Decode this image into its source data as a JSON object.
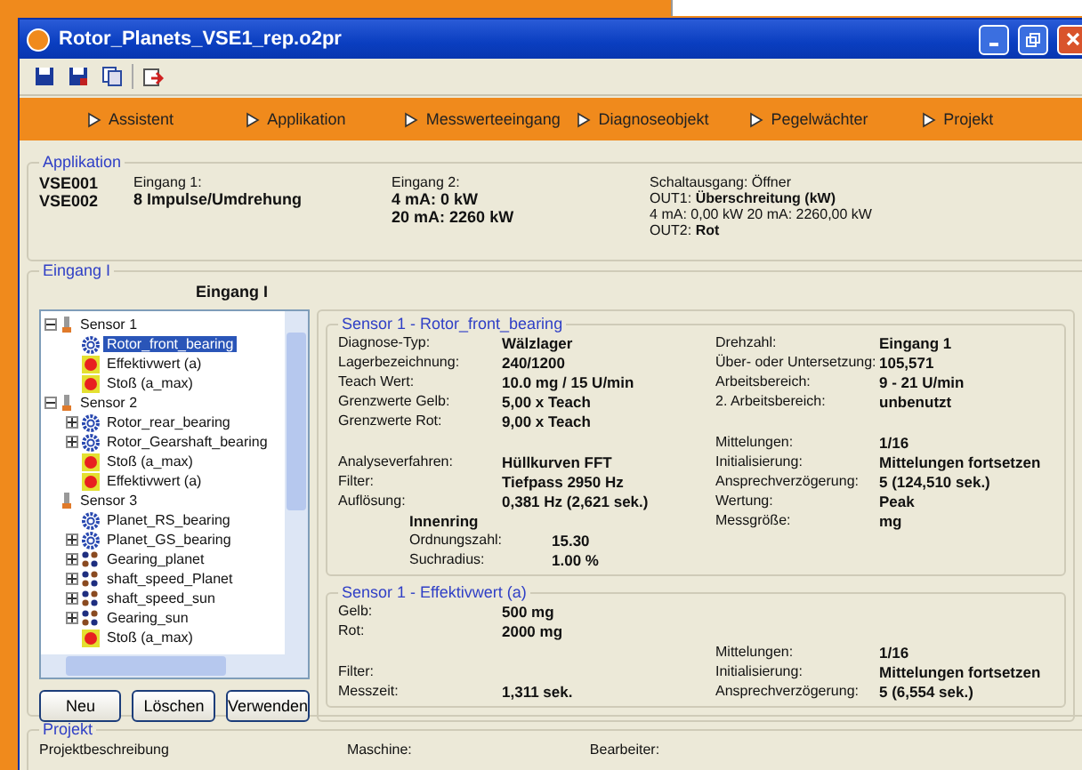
{
  "window": {
    "title": "Rotor_Planets_VSE1_rep.o2pr"
  },
  "toolbar": [
    {
      "kind": "save"
    },
    {
      "kind": "save-as"
    },
    {
      "kind": "copy"
    },
    {
      "kind": "export"
    }
  ],
  "nav": [
    {
      "label": "Assistent"
    },
    {
      "label": "Applikation"
    },
    {
      "label": "Messwerteeingang"
    },
    {
      "label": "Diagnoseobjekt"
    },
    {
      "label": "Pegelwächter"
    },
    {
      "label": "Projekt"
    }
  ],
  "applikation": {
    "title": "Applikation",
    "devices": [
      "VSE001",
      "VSE002"
    ],
    "columns": [
      {
        "label": "Eingang 1:",
        "lines": [
          "8 Impulse/Umdrehung"
        ]
      },
      {
        "label": "Eingang 2:",
        "lines": [
          "4 mA: 0 kW",
          "20 mA: 2260 kW"
        ]
      }
    ],
    "output": {
      "lines": [
        "Schaltausgang: Öffner",
        "OUT1: **Überschreitung (kW)**",
        "4 mA: 0,00 kW  20 mA: 2260,00 kW",
        "OUT2: **Rot**"
      ]
    }
  },
  "eingang": {
    "title": "Eingang I",
    "heading": "Eingang I",
    "tree": [
      {
        "label": "Sensor 1",
        "kind": "sensor",
        "expanded": true,
        "selected": false,
        "children": [
          {
            "label": "Rotor_front_bearing",
            "kind": "bearing",
            "selected": true
          },
          {
            "label": "Effektivwert (a)",
            "kind": "value",
            "selected": false
          },
          {
            "label": "Stoß (a_max)",
            "kind": "value",
            "selected": false
          }
        ]
      },
      {
        "label": "Sensor 2",
        "kind": "sensor",
        "expanded": true,
        "selected": false,
        "children": [
          {
            "label": "Rotor_rear_bearing",
            "kind": "bearing",
            "expanded": false,
            "selected": false
          },
          {
            "label": "Rotor_Gearshaft_bearing",
            "kind": "bearing",
            "expanded": false,
            "selected": false
          },
          {
            "label": "Stoß (a_max)",
            "kind": "value",
            "selected": false
          },
          {
            "label": "Effektivwert (a)",
            "kind": "value",
            "selected": false
          }
        ]
      },
      {
        "label": "Sensor 3",
        "kind": "sensor",
        "selected": false,
        "children": [
          {
            "label": "Planet_RS_bearing",
            "kind": "bearing",
            "selected": false
          },
          {
            "label": "Planet_GS_bearing",
            "kind": "bearing",
            "expanded": false,
            "selected": false
          },
          {
            "label": "Gearing_planet",
            "kind": "gearing",
            "expanded": false,
            "selected": false
          },
          {
            "label": "shaft_speed_Planet",
            "kind": "gearing",
            "expanded": false,
            "selected": false
          },
          {
            "label": "shaft_speed_sun",
            "kind": "gearing",
            "expanded": false,
            "selected": false
          },
          {
            "label": "Gearing_sun",
            "kind": "gearing",
            "expanded": false,
            "selected": false
          },
          {
            "label": "Stoß (a_max)",
            "kind": "value",
            "selected": false
          }
        ]
      }
    ],
    "buttons": [
      "Neu",
      "Löschen",
      "Verwenden"
    ],
    "groups": [
      {
        "title": "Sensor 1 - Rotor_front_bearing",
        "left": [
          [
            {
              "label": "Diagnose-Typ:",
              "value": "Wälzlager"
            },
            {
              "label": "Lagerbezeichnung:",
              "value": "240/1200"
            },
            {
              "label": "Teach Wert:",
              "value": "10.0 mg / 15 U/min"
            },
            {
              "label": "Grenzwerte Gelb:",
              "value": "5,00 x Teach"
            },
            {
              "label": "Grenzwerte Rot:",
              "value": "9,00 x Teach"
            }
          ],
          [
            {
              "label": "Analyseverfahren:",
              "value": "Hüllkurven FFT"
            },
            {
              "label": "Filter:",
              "value": "Tiefpass 2950 Hz"
            },
            {
              "label": "Auflösung:",
              "value": "0,381 Hz (2,621 sek.)"
            }
          ]
        ],
        "inner": {
          "title": "Innenring",
          "rows": [
            {
              "label": "Ordnungszahl:",
              "value": "15.30"
            },
            {
              "label": "Suchradius:",
              "value": "1.00 %"
            }
          ]
        },
        "right": [
          [
            {
              "label": "Drehzahl:",
              "value": "Eingang 1"
            },
            {
              "label": "Über- oder Untersetzung:",
              "value": "105,571"
            },
            {
              "label": "Arbeitsbereich:",
              "value": "9 - 21 U/min"
            },
            {
              "label": "2. Arbeitsbereich:",
              "value": "unbenutzt"
            }
          ],
          [
            {
              "label": "Mittelungen:",
              "value": "1/16"
            },
            {
              "label": "Initialisierung:",
              "value": "Mittelungen fortsetzen"
            },
            {
              "label": "Ansprechverzögerung:",
              "value": "5 (124,510 sek.)"
            },
            {
              "label": "Wertung:",
              "value": "Peak"
            },
            {
              "label": "Messgröße:",
              "value": "mg"
            }
          ]
        ]
      },
      {
        "title": "Sensor 1 - Effektivwert (a)",
        "left": [
          [
            {
              "label": "Gelb:",
              "value": "500 mg"
            },
            {
              "label": "Rot:",
              "value": "2000 mg"
            }
          ],
          [
            {
              "label": "Filter:"
            },
            {
              "label": "Messzeit:",
              "value": "1,311 sek."
            }
          ]
        ],
        "right": [
          [
            {
              "label": "Mittelungen:",
              "value": "1/16"
            },
            {
              "label": "Initialisierung:",
              "value": "Mittelungen fortsetzen"
            },
            {
              "label": "Ansprechverzögerung:",
              "value": "5 (6,554 sek.)"
            }
          ]
        ]
      }
    ]
  },
  "projekt": {
    "title": "Projekt",
    "labels": [
      "Projektbeschreibung",
      "Maschine:",
      "Bearbeiter:"
    ]
  }
}
